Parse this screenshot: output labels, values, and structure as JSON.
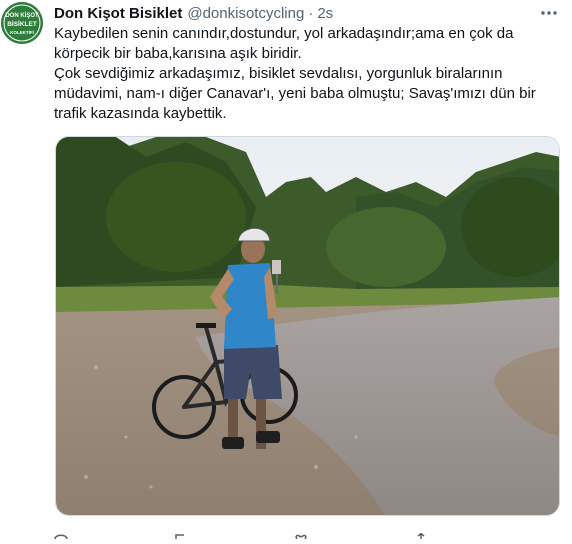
{
  "tweet": {
    "author": {
      "display_name": "Don Kişot Bisiklet",
      "handle": "@donkisotcycling",
      "avatar_icon": "don-kisot-bisiklet-kolektifi-logo",
      "avatar_logo_text": [
        "DON KİŞOT",
        "BİSİKLET",
        "KOLEKTİFİ"
      ]
    },
    "separator": "·",
    "timestamp": "2s",
    "text_lines": [
      "Kaybedilen senin canındır,dostundur, yol arkadaşındır;ama en çok da",
      "körpecik bir baba,karısına aşık biridir.",
      "Çok sevdiğimiz arkadaşımız, bisiklet sevdalısı, yorgunluk biralarının",
      "müdavimi, nam-ı diğer Canavar'ı, yeni baba olmuştu; Savaş'ımızı dün bir",
      "trafik kazasında kaybettik."
    ],
    "media": {
      "icon": "photo-cyclist-on-road"
    },
    "icons": {
      "more": "more-options-icon",
      "reply": "reply-icon",
      "retweet": "retweet-icon",
      "like": "like-icon",
      "share": "share-icon"
    },
    "colors": {
      "text": "#0f1419",
      "secondary": "#536471",
      "border": "#cfd9de",
      "avatar_green": "#2f7d3b"
    }
  }
}
